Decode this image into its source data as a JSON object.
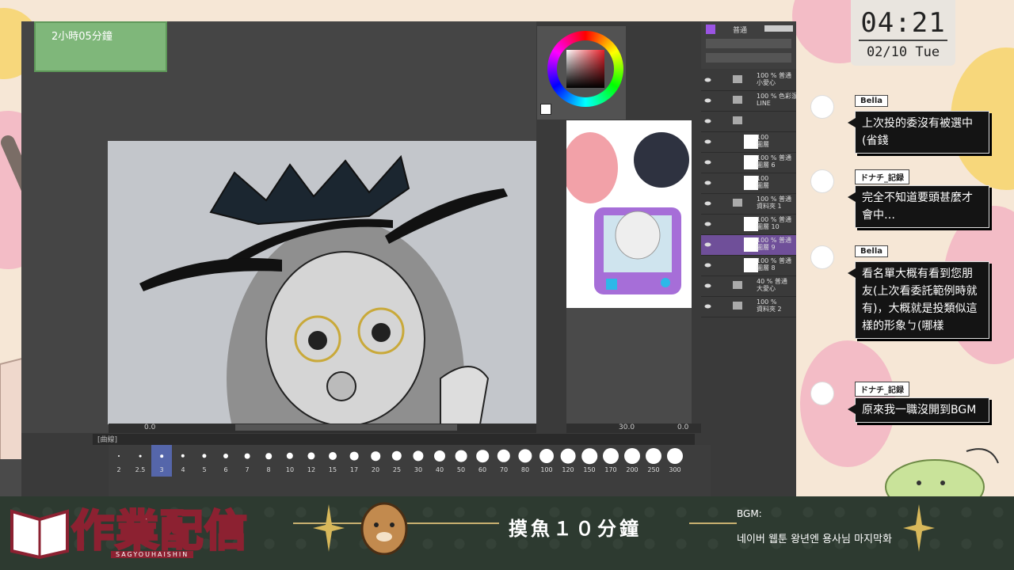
{
  "work_timer": "2小時05分鐘",
  "clock": {
    "time": "04:21",
    "date": "02/10 Tue"
  },
  "canvas_status": {
    "left_value": "0.0"
  },
  "navigator_status": {
    "zoom": "30.0",
    "rotation": "0.0"
  },
  "brush_panel": {
    "title": "[曲線]",
    "sizes": [
      "2",
      "2.5",
      "3",
      "4",
      "5",
      "6",
      "7",
      "8",
      "10",
      "12",
      "15",
      "17",
      "20",
      "25",
      "30",
      "40",
      "50",
      "60",
      "70",
      "80",
      "100",
      "120",
      "150",
      "170",
      "200",
      "250",
      "300"
    ],
    "selected": "3"
  },
  "layer_panel": {
    "blend_mode": "普通",
    "layers": [
      {
        "name": "100 % 普通\n小愛心",
        "type": "folder"
      },
      {
        "name": "100 % 色彩混\nLINE",
        "type": "folder"
      },
      {
        "name": "",
        "type": "folder"
      },
      {
        "name": "100\n圖層",
        "type": "layer"
      },
      {
        "name": "100 % 普通\n圖層 6",
        "type": "layer"
      },
      {
        "name": "100\n圖層",
        "type": "layer"
      },
      {
        "name": "100 % 普通\n資料夾 1",
        "type": "folder"
      },
      {
        "name": "100 % 普通\n圖層 10",
        "type": "layer"
      },
      {
        "name": "100 % 普通\n圖層 9",
        "type": "layer"
      },
      {
        "name": "100 % 普通\n圖層 8",
        "type": "layer"
      },
      {
        "name": "40 % 普通\n大愛心",
        "type": "folder"
      },
      {
        "name": "100 %\n資料夾 2",
        "type": "folder"
      }
    ]
  },
  "chat": [
    {
      "user": "Bella",
      "message": "上次投的委沒有被選中(省錢"
    },
    {
      "user": "ドナチ_記録",
      "message": "完全不知道要頭甚麼才會中…"
    },
    {
      "user": "Bella",
      "message": "看名單大概有看到您朋友(上次看委託範例時就有)，大概就是投類似這樣的形象ㄅ(哪樣"
    },
    {
      "user": "ドナチ_記録",
      "message": "原來我一職沒開到BGM"
    }
  ],
  "banner": {
    "logo_text": "作業配信",
    "logo_sub": "SAGYOUHAISHIN",
    "title": "摸魚１０分鐘",
    "bgm_label": "BGM:",
    "bgm_song": "네이버 웹툰 왕년엔 용사님 마지막화"
  },
  "colors": {
    "layer_highlight": "#6f4f99",
    "timer_bg": "#7fb77a",
    "banner_bg": "#2d3a30",
    "logo_stroke": "#8c2131"
  }
}
